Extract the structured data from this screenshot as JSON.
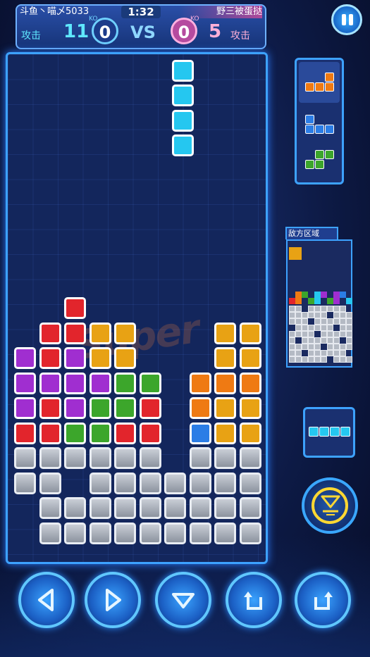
{
  "header": {
    "player_left": "斗鱼丶喵乄5033",
    "player_right": "野三被蛋挞",
    "timer": "1:32",
    "attack_label_left": "攻击",
    "attack_value_left": "11",
    "attack_label_right": "攻击",
    "attack_value_right": "5",
    "ko_label_left": "KO",
    "ko_label_right": "KO",
    "ko_left": "0",
    "ko_right": "0",
    "vs": "VS"
  },
  "watermark": "Super",
  "enemy_area_label": "敌方区域",
  "colors": {
    "red": "#e2252c",
    "purple": "#a02ed0",
    "yellow": "#e8a214",
    "green": "#3ca62b",
    "orange": "#ef7a13",
    "blue": "#2b7de6",
    "cyan": "#25c7f0",
    "gray": "#9aa1ad"
  },
  "board": {
    "falling_piece": {
      "type": "I",
      "color": "cyan",
      "cols": [
        6
      ],
      "rows": [
        0,
        1,
        2,
        3
      ]
    },
    "cells": [
      {
        "r": 10,
        "c": 2,
        "color": "red"
      },
      {
        "r": 11,
        "c": 1,
        "color": "red"
      },
      {
        "r": 11,
        "c": 2,
        "color": "red"
      },
      {
        "r": 11,
        "c": 3,
        "color": "yellow"
      },
      {
        "r": 11,
        "c": 4,
        "color": "yellow"
      },
      {
        "r": 11,
        "c": 8,
        "color": "yellow"
      },
      {
        "r": 11,
        "c": 9,
        "color": "yellow"
      },
      {
        "r": 12,
        "c": 0,
        "color": "purple"
      },
      {
        "r": 12,
        "c": 1,
        "color": "red"
      },
      {
        "r": 12,
        "c": 2,
        "color": "purple"
      },
      {
        "r": 12,
        "c": 3,
        "color": "yellow"
      },
      {
        "r": 12,
        "c": 4,
        "color": "yellow"
      },
      {
        "r": 12,
        "c": 8,
        "color": "yellow"
      },
      {
        "r": 12,
        "c": 9,
        "color": "yellow"
      },
      {
        "r": 13,
        "c": 0,
        "color": "purple"
      },
      {
        "r": 13,
        "c": 1,
        "color": "purple"
      },
      {
        "r": 13,
        "c": 2,
        "color": "purple"
      },
      {
        "r": 13,
        "c": 3,
        "color": "purple"
      },
      {
        "r": 13,
        "c": 4,
        "color": "green"
      },
      {
        "r": 13,
        "c": 5,
        "color": "green"
      },
      {
        "r": 13,
        "c": 7,
        "color": "orange"
      },
      {
        "r": 13,
        "c": 8,
        "color": "orange"
      },
      {
        "r": 13,
        "c": 9,
        "color": "orange"
      },
      {
        "r": 14,
        "c": 0,
        "color": "purple"
      },
      {
        "r": 14,
        "c": 1,
        "color": "red"
      },
      {
        "r": 14,
        "c": 2,
        "color": "purple"
      },
      {
        "r": 14,
        "c": 3,
        "color": "green"
      },
      {
        "r": 14,
        "c": 4,
        "color": "green"
      },
      {
        "r": 14,
        "c": 5,
        "color": "red"
      },
      {
        "r": 14,
        "c": 7,
        "color": "orange"
      },
      {
        "r": 14,
        "c": 8,
        "color": "yellow"
      },
      {
        "r": 14,
        "c": 9,
        "color": "yellow"
      },
      {
        "r": 15,
        "c": 0,
        "color": "red"
      },
      {
        "r": 15,
        "c": 1,
        "color": "red"
      },
      {
        "r": 15,
        "c": 2,
        "color": "green"
      },
      {
        "r": 15,
        "c": 3,
        "color": "green"
      },
      {
        "r": 15,
        "c": 4,
        "color": "red"
      },
      {
        "r": 15,
        "c": 5,
        "color": "red"
      },
      {
        "r": 15,
        "c": 7,
        "color": "blue"
      },
      {
        "r": 15,
        "c": 8,
        "color": "yellow"
      },
      {
        "r": 15,
        "c": 9,
        "color": "yellow"
      },
      {
        "r": 16,
        "c": 0,
        "color": "gray"
      },
      {
        "r": 16,
        "c": 1,
        "color": "gray"
      },
      {
        "r": 16,
        "c": 2,
        "color": "gray"
      },
      {
        "r": 16,
        "c": 3,
        "color": "gray"
      },
      {
        "r": 16,
        "c": 4,
        "color": "gray"
      },
      {
        "r": 16,
        "c": 5,
        "color": "gray"
      },
      {
        "r": 16,
        "c": 7,
        "color": "gray"
      },
      {
        "r": 16,
        "c": 8,
        "color": "gray"
      },
      {
        "r": 16,
        "c": 9,
        "color": "gray"
      },
      {
        "r": 17,
        "c": 0,
        "color": "gray"
      },
      {
        "r": 17,
        "c": 1,
        "color": "gray"
      },
      {
        "r": 17,
        "c": 3,
        "color": "gray"
      },
      {
        "r": 17,
        "c": 4,
        "color": "gray"
      },
      {
        "r": 17,
        "c": 5,
        "color": "gray"
      },
      {
        "r": 17,
        "c": 6,
        "color": "gray"
      },
      {
        "r": 17,
        "c": 7,
        "color": "gray"
      },
      {
        "r": 17,
        "c": 8,
        "color": "gray"
      },
      {
        "r": 17,
        "c": 9,
        "color": "gray"
      },
      {
        "r": 18,
        "c": 1,
        "color": "gray"
      },
      {
        "r": 18,
        "c": 2,
        "color": "gray"
      },
      {
        "r": 18,
        "c": 3,
        "color": "gray"
      },
      {
        "r": 18,
        "c": 4,
        "color": "gray"
      },
      {
        "r": 18,
        "c": 5,
        "color": "gray"
      },
      {
        "r": 18,
        "c": 6,
        "color": "gray"
      },
      {
        "r": 18,
        "c": 7,
        "color": "gray"
      },
      {
        "r": 18,
        "c": 8,
        "color": "gray"
      },
      {
        "r": 18,
        "c": 9,
        "color": "gray"
      },
      {
        "r": 19,
        "c": 1,
        "color": "gray"
      },
      {
        "r": 19,
        "c": 2,
        "color": "gray"
      },
      {
        "r": 19,
        "c": 3,
        "color": "gray"
      },
      {
        "r": 19,
        "c": 4,
        "color": "gray"
      },
      {
        "r": 19,
        "c": 5,
        "color": "gray"
      },
      {
        "r": 19,
        "c": 6,
        "color": "gray"
      },
      {
        "r": 19,
        "c": 7,
        "color": "gray"
      },
      {
        "r": 19,
        "c": 8,
        "color": "gray"
      },
      {
        "r": 19,
        "c": 9,
        "color": "gray"
      }
    ]
  },
  "next_queue": [
    {
      "type": "L",
      "color": "orange"
    },
    {
      "type": "J",
      "color": "blue"
    },
    {
      "type": "S",
      "color": "green"
    }
  ],
  "hold_piece": {
    "type": "I",
    "color": "cyan"
  },
  "controls": [
    "move-left",
    "move-right",
    "soft-drop",
    "rotate-left",
    "rotate-right",
    "hard-drop"
  ],
  "icons": [
    "pause-icon",
    "left-arrow-icon",
    "right-arrow-icon",
    "down-arrow-icon",
    "rotate-ccw-icon",
    "rotate-cw-icon",
    "hard-drop-icon"
  ]
}
